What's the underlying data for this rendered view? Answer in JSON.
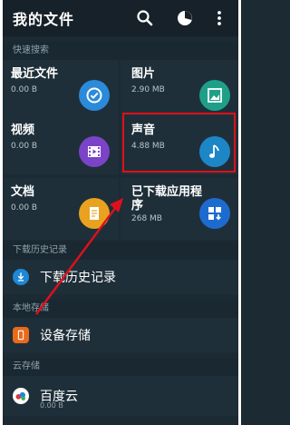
{
  "appbar": {
    "title": "我的文件",
    "actions": [
      {
        "icon": "search-icon"
      },
      {
        "icon": "pie-chart-icon"
      },
      {
        "icon": "more-vert-icon"
      }
    ]
  },
  "sections": {
    "quick_search": "快速搜索",
    "download_history": "下载历史记录",
    "local_storage": "本地存储",
    "cloud_storage": "云存储"
  },
  "tiles": [
    {
      "name": "最近文件",
      "size": "0.00 B",
      "icon": "clock-icon",
      "color": "#2b8ad9"
    },
    {
      "name": "图片",
      "size": "2.90 MB",
      "icon": "image-icon",
      "color": "#1f9f8a"
    },
    {
      "name": "视频",
      "size": "0.00 B",
      "icon": "film-icon",
      "color": "#7a43c8"
    },
    {
      "name": "声音",
      "size": "4.88 MB",
      "icon": "music-note-icon",
      "color": "#1d86c6"
    },
    {
      "name": "文档",
      "size": "0.00 B",
      "icon": "document-icon",
      "color": "#e9a21f"
    },
    {
      "name": "已下载应用程序",
      "size": "268 MB",
      "icon": "apps-download-icon",
      "color": "#1e6bd0"
    }
  ],
  "rows": {
    "download_history": {
      "label": "下载历史记录",
      "icon": "download-icon",
      "color": "#1e88d6"
    },
    "device_storage": {
      "label": "设备存储",
      "icon": "phone-icon",
      "color": "#e86a1b"
    },
    "baidu_cloud": {
      "label": "百度云",
      "sub": "0.00 B",
      "icon": "cloud-icon",
      "color": "#ffffff"
    }
  },
  "annotation": {
    "highlight_color": "#e0101a"
  }
}
